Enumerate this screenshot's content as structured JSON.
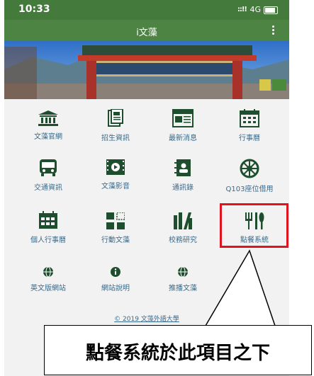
{
  "status_bar": {
    "time": "10:33",
    "signal": "::!!",
    "network": "4G"
  },
  "app_bar": {
    "title": "i文藻"
  },
  "menu_grid": [
    {
      "label": "文藻官網",
      "icon": "bank-icon"
    },
    {
      "label": "招生資訊",
      "icon": "document-icon"
    },
    {
      "label": "最新消息",
      "icon": "news-icon"
    },
    {
      "label": "行事曆",
      "icon": "calendar-icon"
    },
    {
      "label": "交通資訊",
      "icon": "bus-icon"
    },
    {
      "label": "文藻影音",
      "icon": "video-icon"
    },
    {
      "label": "通訊錄",
      "icon": "contacts-icon"
    },
    {
      "label": "Q103座位借用",
      "icon": "seat-wheel-icon"
    },
    {
      "label": "個人行事曆",
      "icon": "personal-calendar-icon"
    },
    {
      "label": "行動文藻",
      "icon": "qr-code-icon"
    },
    {
      "label": "校務研究",
      "icon": "research-chart-icon"
    },
    {
      "label": "點餐系統",
      "icon": "fork-knife-icon"
    },
    {
      "label": "英文版網站",
      "icon": "globe-icon"
    },
    {
      "label": "網站說明",
      "icon": "info-icon"
    },
    {
      "label": "推播文藻",
      "icon": "globe-icon"
    },
    {
      "label": "",
      "icon": ""
    }
  ],
  "footer": {
    "copyright": "© 2019 文藻外語大學"
  },
  "annotation": {
    "callout_text": "點餐系統於此項目之下"
  },
  "colors": {
    "status_bar": "#447a3c",
    "app_bar": "#4d8443",
    "icon": "#1f4e2f",
    "label": "#3a6a8a",
    "highlight": "#e0141e"
  }
}
